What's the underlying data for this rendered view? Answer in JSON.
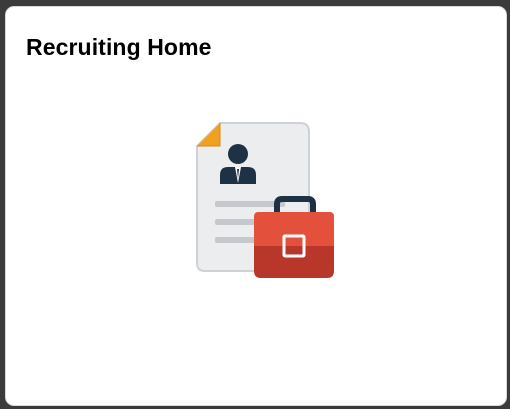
{
  "tile": {
    "title": "Recruiting Home",
    "icon": "recruiting-home-icon",
    "colors": {
      "document": "#ebedef",
      "document_border": "#cfd2d5",
      "folded_corner": "#f2a01f",
      "person": "#1f3145",
      "lines": "#c5c9cd",
      "briefcase": "#e3513c",
      "briefcase_dark": "#b8372a",
      "briefcase_handle": "#1f3145"
    }
  }
}
